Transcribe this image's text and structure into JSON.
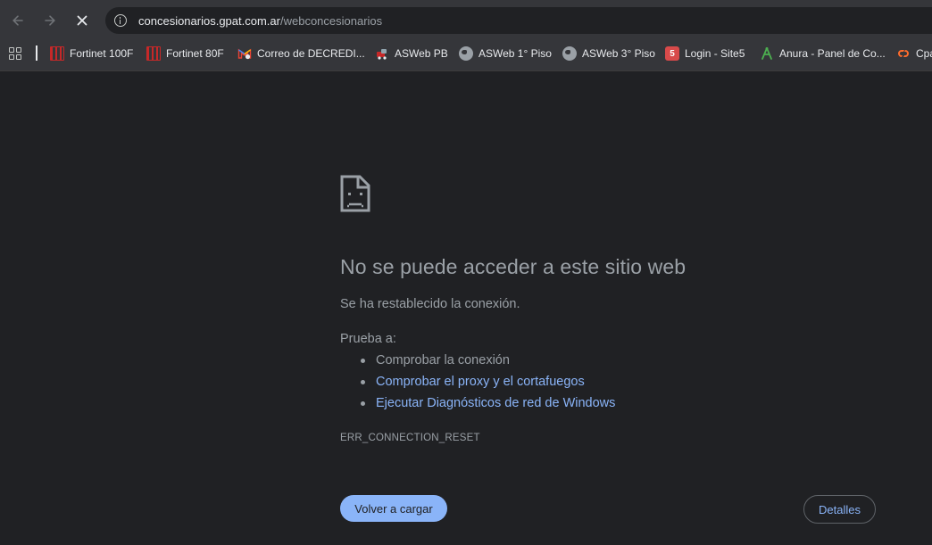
{
  "toolbar": {
    "back_icon": "arrow-left-icon",
    "forward_icon": "arrow-right-icon",
    "stop_icon": "close-icon",
    "site_info_icon": "info-icon",
    "url_host": "concesionarios.gpat.com.ar",
    "url_path": "/webconcesionarios"
  },
  "bookmarks": {
    "apps_icon": "apps-grid-icon",
    "items": [
      {
        "label": "Fortinet 100F",
        "icon": "fortinet-icon"
      },
      {
        "label": "Fortinet 80F",
        "icon": "fortinet-icon"
      },
      {
        "label": "Correo de DECREDI...",
        "icon": "gmail-icon"
      },
      {
        "label": "ASWeb PB",
        "icon": "asweb-icon"
      },
      {
        "label": "ASWeb 1° Piso",
        "icon": "globe-icon"
      },
      {
        "label": "ASWeb 3° Piso",
        "icon": "globe-icon"
      },
      {
        "label": "Login - Site5",
        "icon": "site5-icon"
      },
      {
        "label": "Anura - Panel de Co...",
        "icon": "anura-icon"
      },
      {
        "label": "Cpa",
        "icon": "cpanel-icon"
      }
    ]
  },
  "error_page": {
    "icon": "sad-document-icon",
    "title": "No se puede acceder a este sitio web",
    "subtitle": "Se ha restablecido la conexión.",
    "try_label": "Prueba a:",
    "suggestions": [
      "Comprobar la conexión",
      "Comprobar el proxy y el cortafuegos",
      "Ejecutar Diagnósticos de red de Windows"
    ],
    "error_code": "ERR_CONNECTION_RESET",
    "reload_button": "Volver a cargar",
    "details_button": "Detalles"
  },
  "colors": {
    "background": "#202124",
    "toolbar": "#35363a",
    "link": "#8ab4f8",
    "text_muted": "#9aa0a6",
    "primary_button": "#8ab4f8"
  }
}
